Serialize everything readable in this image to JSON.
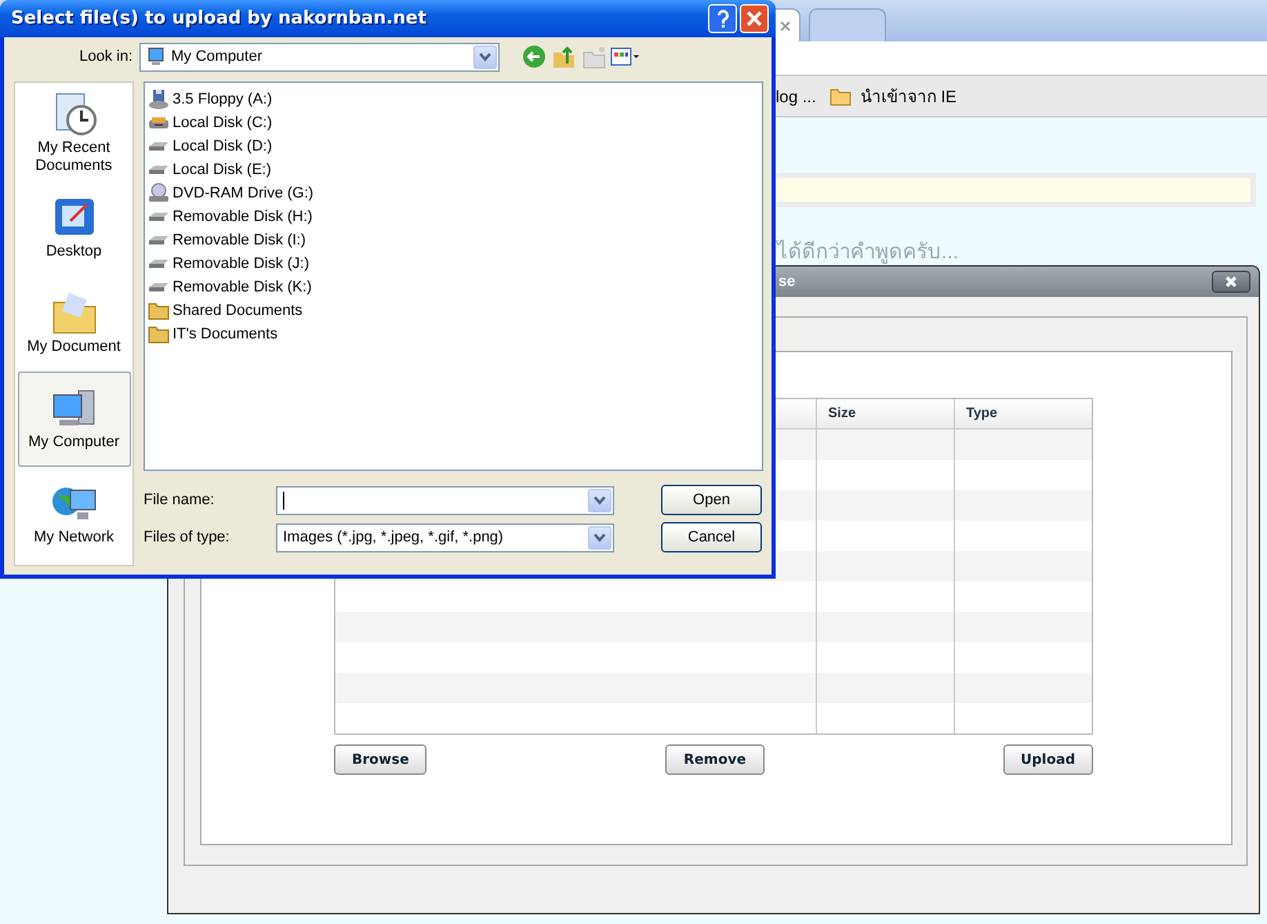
{
  "browser": {
    "bookmarks": [
      {
        "label": "log ...",
        "kind": "text"
      },
      {
        "label": "นำเข้าจาก IE",
        "kind": "folder"
      }
    ],
    "page_text": "ได้ดีกว่าคำพูดครับ..."
  },
  "upload_window": {
    "title": "se",
    "columns": [
      {},
      {
        "label": "Size"
      },
      {
        "label": "Type"
      }
    ],
    "buttons": [
      "Browse",
      "Remove",
      "Upload"
    ]
  },
  "dialog": {
    "title": "Select file(s) to upload by nakornban.net",
    "look_in_label": "Look in:",
    "location": "My Computer",
    "places": [
      {
        "label": "My Recent Documents",
        "kind": "recent",
        "selected": false
      },
      {
        "label": "Desktop",
        "kind": "desktop",
        "selected": false
      },
      {
        "label": "My Document",
        "kind": "documents",
        "selected": false
      },
      {
        "label": "My Computer",
        "kind": "computer",
        "selected": true
      },
      {
        "label": "My Network",
        "kind": "network",
        "selected": false
      }
    ],
    "files": [
      {
        "name": "3.5 Floppy (A:)",
        "kind": "floppy"
      },
      {
        "name": "Local Disk (C:)",
        "kind": "system"
      },
      {
        "name": "Local Disk (D:)",
        "kind": "disk"
      },
      {
        "name": "Local Disk (E:)",
        "kind": "disk"
      },
      {
        "name": "DVD-RAM Drive (G:)",
        "kind": "dvd"
      },
      {
        "name": "Removable Disk (H:)",
        "kind": "disk"
      },
      {
        "name": "Removable Disk (I:)",
        "kind": "disk"
      },
      {
        "name": "Removable Disk (J:)",
        "kind": "disk"
      },
      {
        "name": "Removable Disk (K:)",
        "kind": "disk"
      },
      {
        "name": "Shared Documents",
        "kind": "folder"
      },
      {
        "name": "IT's Documents",
        "kind": "folder"
      }
    ],
    "file_name_label": "File name:",
    "file_type_label": "Files of type:",
    "file_type": "Images (*.jpg, *.jpeg, *.gif, *.png)",
    "buttons": [
      "Open",
      "Cancel"
    ]
  }
}
